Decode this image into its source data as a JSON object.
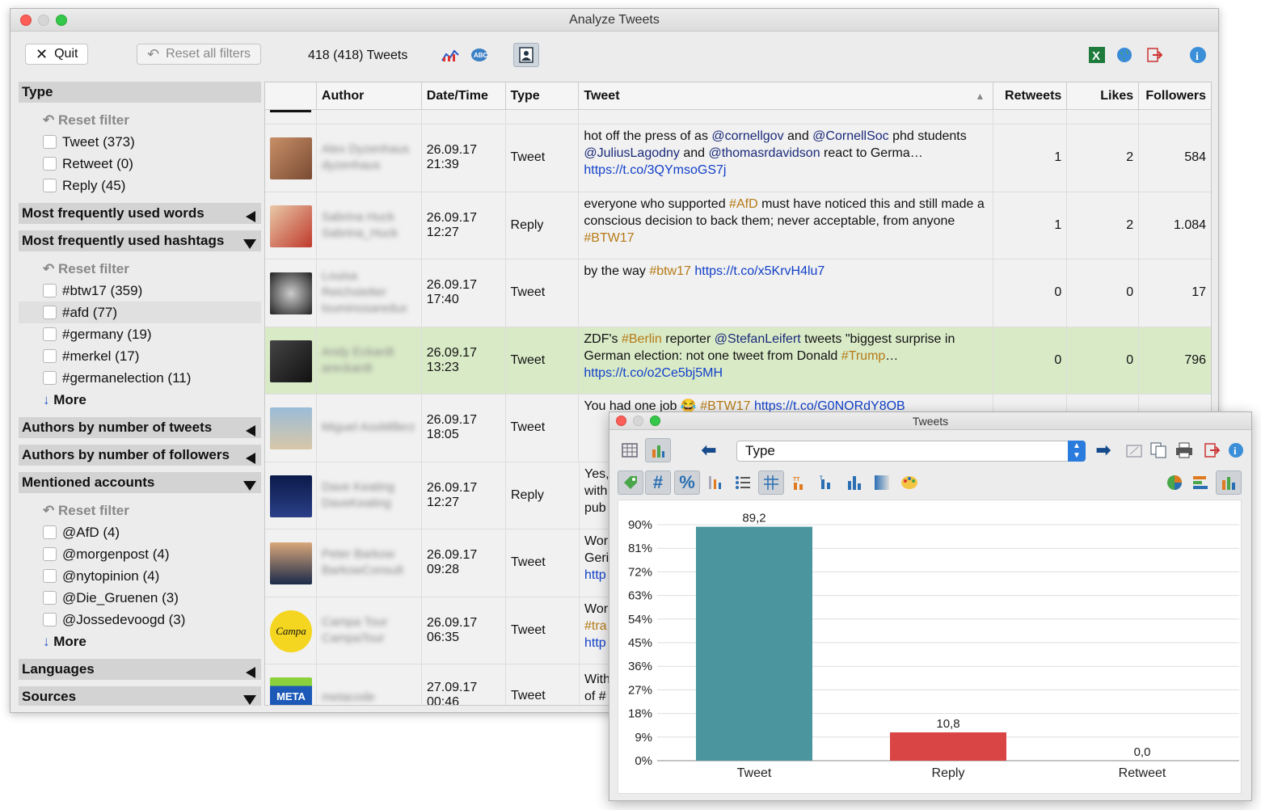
{
  "window": {
    "title": "Analyze Tweets"
  },
  "toolbar": {
    "quit": "Quit",
    "reset_all": "Reset all filters",
    "count": "418 (418) Tweets"
  },
  "sidebar": {
    "type": {
      "title": "Type",
      "reset": "Reset filter",
      "items": [
        "Tweet (373)",
        "Retweet (0)",
        "Reply (45)"
      ]
    },
    "words": {
      "title": "Most frequently used words"
    },
    "hashtags": {
      "title": "Most frequently used hashtags",
      "reset": "Reset filter",
      "items": [
        "#btw17 (359)",
        "#afd (77)",
        "#germany (19)",
        "#merkel (17)",
        "#germanelection (11)"
      ],
      "more": "More"
    },
    "authors_tweets": {
      "title": "Authors by number of tweets"
    },
    "authors_followers": {
      "title": "Authors by number of followers"
    },
    "mentioned": {
      "title": "Mentioned accounts",
      "reset": "Reset filter",
      "items": [
        "@AfD (4)",
        "@morgenpost (4)",
        "@nytopinion (4)",
        "@Die_Gruenen (3)",
        "@Jossedevoogd (3)"
      ],
      "more": "More"
    },
    "languages": {
      "title": "Languages"
    },
    "sources": {
      "title": "Sources"
    }
  },
  "table": {
    "columns": [
      "Author",
      "Date/Time",
      "Type",
      "Tweet",
      "Retweets",
      "Likes",
      "Followers"
    ],
    "rows": [
      {
        "author": "Alex Dyzenhaus dyzenhaus",
        "date": "26.09.17",
        "time": "21:39",
        "type": "Tweet",
        "t1": "hot off the press of as ",
        "m1": "@cornellgov",
        "t2": " and ",
        "m2": "@CornellSoc",
        "t3": " phd students ",
        "m3": "@JuliusLagodny",
        "t4": " and ",
        "m4": "@thomasrdavidson",
        "t5": " react to Germa… ",
        "link": "https://t.co/3QYmsoGS7j",
        "retweets": "1",
        "likes": "2",
        "followers": "584"
      },
      {
        "author": "Sabrina Huck Sabrina_Huck",
        "date": "26.09.17",
        "time": "12:27",
        "type": "Reply",
        "t1": "everyone who supported ",
        "h1": "#AfD",
        "t2": " must have noticed this and still made a conscious decision to back them; never acceptable, from anyone ",
        "h2": "#BTW17",
        "retweets": "1",
        "likes": "2",
        "followers": "1.084"
      },
      {
        "author": "Louisa Reichstetter louminosaredux",
        "date": "26.09.17",
        "time": "17:40",
        "type": "Tweet",
        "t1": "by the way ",
        "h1": "#btw17",
        "t2": " ",
        "link": "https://t.co/x5KrvH4lu7",
        "retweets": "0",
        "likes": "0",
        "followers": "17"
      },
      {
        "author": "Andy Eckardt areckardt",
        "date": "26.09.17",
        "time": "13:23",
        "type": "Tweet",
        "t1": "ZDF's ",
        "h1": "#Berlin",
        "t2": " reporter ",
        "m1": "@StefanLeifert",
        "t3": " tweets \"biggest surprise in German election: not one tweet from Donald ",
        "h2": "#Trump",
        "t4": "… ",
        "link": "https://t.co/o2Ce5bj5MH",
        "retweets": "0",
        "likes": "0",
        "followers": "796"
      },
      {
        "author": "Miguel AssMillerz",
        "date": "26.09.17",
        "time": "18:05",
        "type": "Tweet",
        "t1": "You had one job 😂 ",
        "h1": "#BTW17",
        "link": "https://t.co/G0NORdY8OB"
      },
      {
        "author": "Dave Keating DaveKeating",
        "date": "26.09.17",
        "time": "12:27",
        "type": "Reply",
        "t1": "Yes, with pub"
      },
      {
        "author": "Peter Barkow BarkowConsult",
        "date": "26.09.17",
        "time": "09:28",
        "type": "Tweet",
        "t1": "Wor Geri",
        "link": "http"
      },
      {
        "author": "Campa Tour CampaTour",
        "date": "26.09.17",
        "time": "06:35",
        "type": "Tweet",
        "t1": "Wor",
        "h1": "#tra",
        "link": "http"
      },
      {
        "author": "metacode",
        "date": "27.09.17",
        "time": "00:46",
        "type": "Tweet",
        "t1": "With of #"
      }
    ]
  },
  "popup": {
    "title": "Tweets",
    "select": "Type",
    "chart_data": {
      "type": "bar",
      "categories": [
        "Tweet",
        "Reply",
        "Retweet"
      ],
      "values": [
        89.2,
        10.8,
        0.0
      ],
      "labels": [
        "89,2",
        "10,8",
        "0,0"
      ],
      "colors": [
        "#4a959e",
        "#d94444",
        "#999999"
      ],
      "yticks": [
        "0%",
        "9%",
        "18%",
        "27%",
        "36%",
        "45%",
        "54%",
        "63%",
        "72%",
        "81%",
        "90%"
      ],
      "ylim": [
        0,
        90
      ],
      "grid": true
    }
  }
}
